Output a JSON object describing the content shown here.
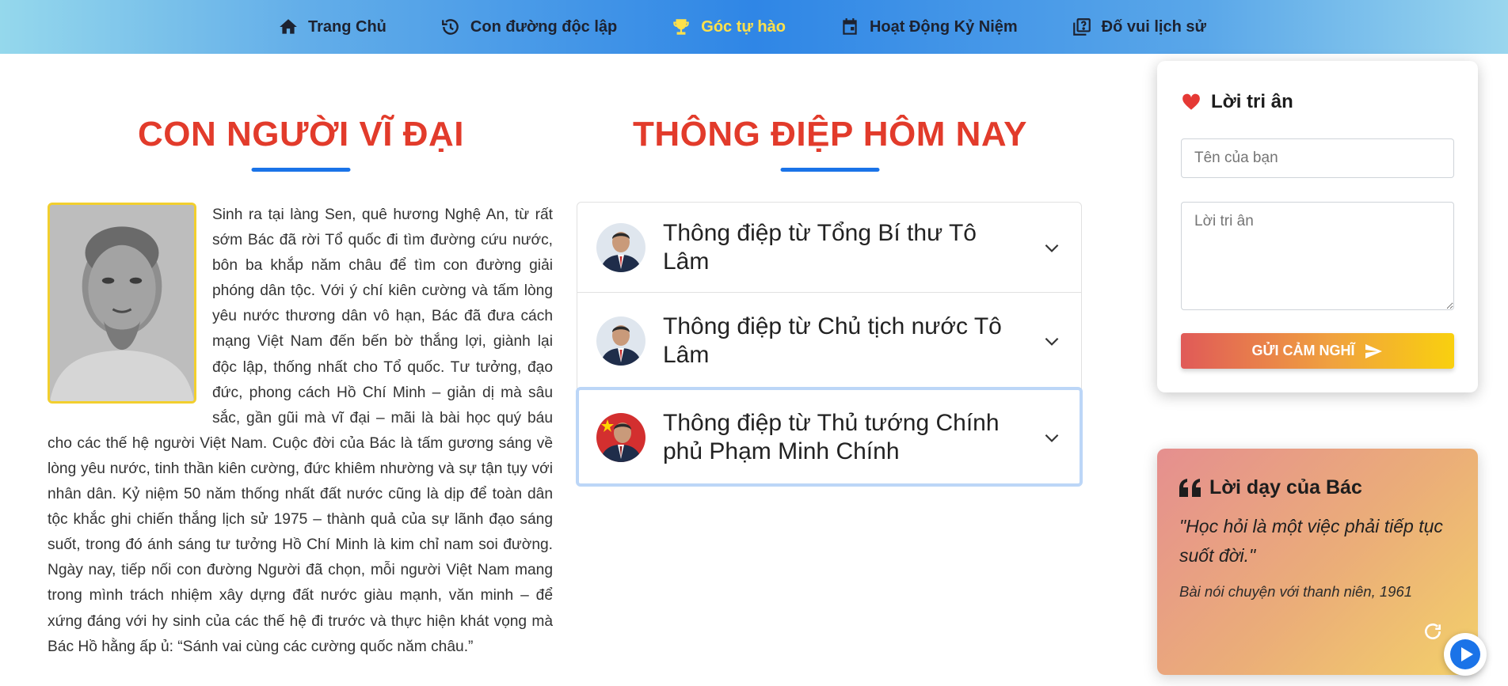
{
  "nav": {
    "items": [
      {
        "label": "Trang Chủ",
        "icon": "home-icon"
      },
      {
        "label": "Con đường độc lập",
        "icon": "history-icon"
      },
      {
        "label": "Góc tự hào",
        "icon": "trophy-icon"
      },
      {
        "label": "Hoạt Động Kỷ Niệm",
        "icon": "calendar-icon"
      },
      {
        "label": "Đố vui lịch sử",
        "icon": "quiz-icon"
      }
    ],
    "active_index": 2,
    "active_color": "#ffe14a"
  },
  "left_section": {
    "title": "CON NGƯỜI VĨ ĐẠI",
    "body": "Sinh ra tại làng Sen, quê hương Nghệ An, từ rất sớm Bác đã rời Tổ quốc đi tìm đường cứu nước, bôn ba khắp năm châu để tìm con đường giải phóng dân tộc. Với ý chí kiên cường và tấm lòng yêu nước thương dân vô hạn, Bác đã đưa cách mạng Việt Nam đến bến bờ thắng lợi, giành lại độc lập, thống nhất cho Tổ quốc. Tư tưởng, đạo đức, phong cách Hồ Chí Minh – giản dị mà sâu sắc, gần gũi mà vĩ đại – mãi là bài học quý báu cho các thế hệ người Việt Nam. Cuộc đời của Bác là tấm gương sáng về lòng yêu nước, tinh thần kiên cường, đức khiêm nhường và sự tận tụy với nhân dân. Kỷ niệm 50 năm thống nhất đất nước cũng là dịp để toàn dân tộc khắc ghi chiến thắng lịch sử 1975 – thành quả của sự lãnh đạo sáng suốt, trong đó ánh sáng tư tưởng Hồ Chí Minh là kim chỉ nam soi đường. Ngày nay, tiếp nối con đường Người đã chọn, mỗi người Việt Nam mang trong mình trách nhiệm xây dựng đất nước giàu mạnh, văn minh – để xứng đáng với hy sinh của các thế hệ đi trước và thực hiện khát vọng mà Bác Hồ hằng ấp ủ: “Sánh vai cùng các cường quốc năm châu.”"
  },
  "middle_section": {
    "title": "THÔNG ĐIỆP HÔM NAY",
    "items": [
      {
        "label": "Thông điệp từ Tổng Bí thư Tô Lâm"
      },
      {
        "label": "Thông điệp từ Chủ tịch nước Tô Lâm"
      },
      {
        "label": "Thông điệp từ Thủ tướng Chính phủ Phạm Minh Chính"
      }
    ]
  },
  "thanks_card": {
    "title": "Lời tri ân",
    "name_placeholder": "Tên của bạn",
    "message_placeholder": "Lời tri ân",
    "submit_label": "GỬI CẢM NGHĨ"
  },
  "quote_card": {
    "title": "Lời dạy của Bác",
    "quote": "\"Học hỏi là một việc phải tiếp tục suốt đời.\"",
    "source": "Bài nói chuyện với thanh niên, 1961"
  },
  "colors": {
    "title_red": "#e23b2b",
    "accent_blue": "#1a73e8",
    "heart_red": "#e53935"
  }
}
